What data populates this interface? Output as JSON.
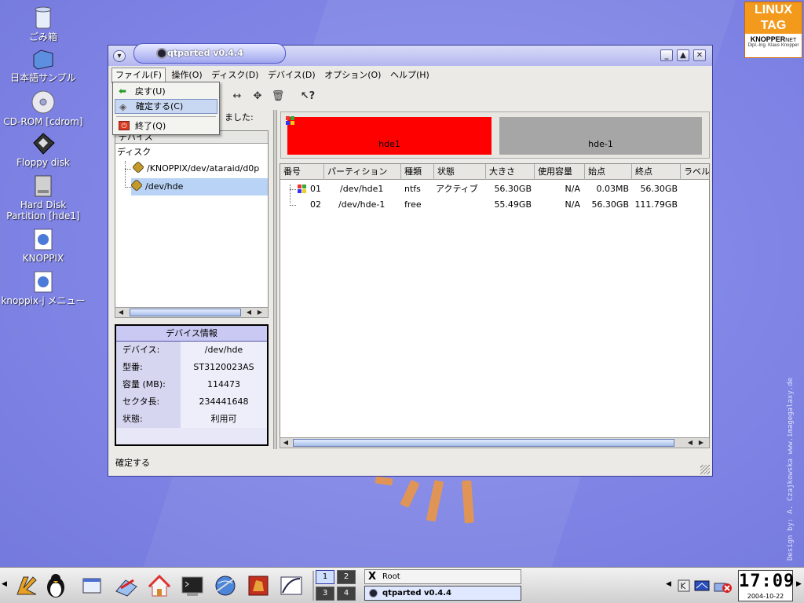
{
  "desktop": {
    "icons": [
      {
        "label": "ごみ箱"
      },
      {
        "label": "日本語サンプル"
      },
      {
        "label": "CD-ROM [cdrom]"
      },
      {
        "label": "Floppy disk"
      },
      {
        "label": "Hard Disk Partition [hde1]"
      },
      {
        "label": "KNOPPIX"
      },
      {
        "label": "knoppix-j メニュー"
      }
    ],
    "logo": {
      "line1": "LINUX",
      "line2": "TAG",
      "line3": "KNOPPER",
      "line3b": "NET",
      "line4": "Dipl.-Ing. Klaus Knopper"
    },
    "credit": "Design by: A. Czajkowska www.imagegalaxy.de"
  },
  "window": {
    "title": "qtparted v0.4.4",
    "menu": [
      "ファイル(F)",
      "操作(O)",
      "ディスク(D)",
      "デバイス(D)",
      "オプション(O)",
      "ヘルプ(H)"
    ],
    "dropdown": [
      {
        "label": "戻す(U)",
        "icon": "undo-arrow-icon"
      },
      {
        "label": "確定する(C)",
        "icon": "commit-disk-icon"
      },
      {
        "label": "終了(Q)",
        "icon": "quit-power-icon"
      }
    ],
    "left_status": "ました:",
    "tree": {
      "header": "デバイス",
      "category": "ディスク",
      "devices": [
        "/KNOPPIX/dev/ataraid/d0p",
        "/dev/hde"
      ]
    },
    "device_info": {
      "title": "デバイス情報",
      "rows": [
        {
          "key": "デバイス:",
          "value": "/dev/hde"
        },
        {
          "key": "型番:",
          "value": "ST3120023AS"
        },
        {
          "key": "容量 (MB):",
          "value": "114473"
        },
        {
          "key": "セクタ長:",
          "value": "234441648"
        },
        {
          "key": "状態:",
          "value": "利用可"
        }
      ]
    },
    "partition_bar": [
      {
        "label": "hde1",
        "color": "#ff0000"
      },
      {
        "label": "hde-1",
        "color": "#a6a6a6"
      }
    ],
    "table": {
      "headers": [
        "番号",
        "パーティション",
        "種類",
        "状態",
        "大きさ",
        "使用容量",
        "始点",
        "終点",
        "ラベル"
      ],
      "rows": [
        [
          "01",
          "/dev/hde1",
          "ntfs",
          "アクティブ",
          "56.30GB",
          "N/A",
          "0.03MB",
          "56.30GB",
          ""
        ],
        [
          "02",
          "/dev/hde-1",
          "free",
          "",
          "55.49GB",
          "N/A",
          "56.30GB",
          "111.79GB",
          ""
        ]
      ]
    },
    "statusbar": "確定する"
  },
  "taskbar": {
    "desktops": [
      "1",
      "2",
      "3",
      "4"
    ],
    "tasks": [
      "Root",
      "qtparted v0.4.4"
    ],
    "clock_time": "17:09",
    "clock_date": "2004-10-22"
  }
}
